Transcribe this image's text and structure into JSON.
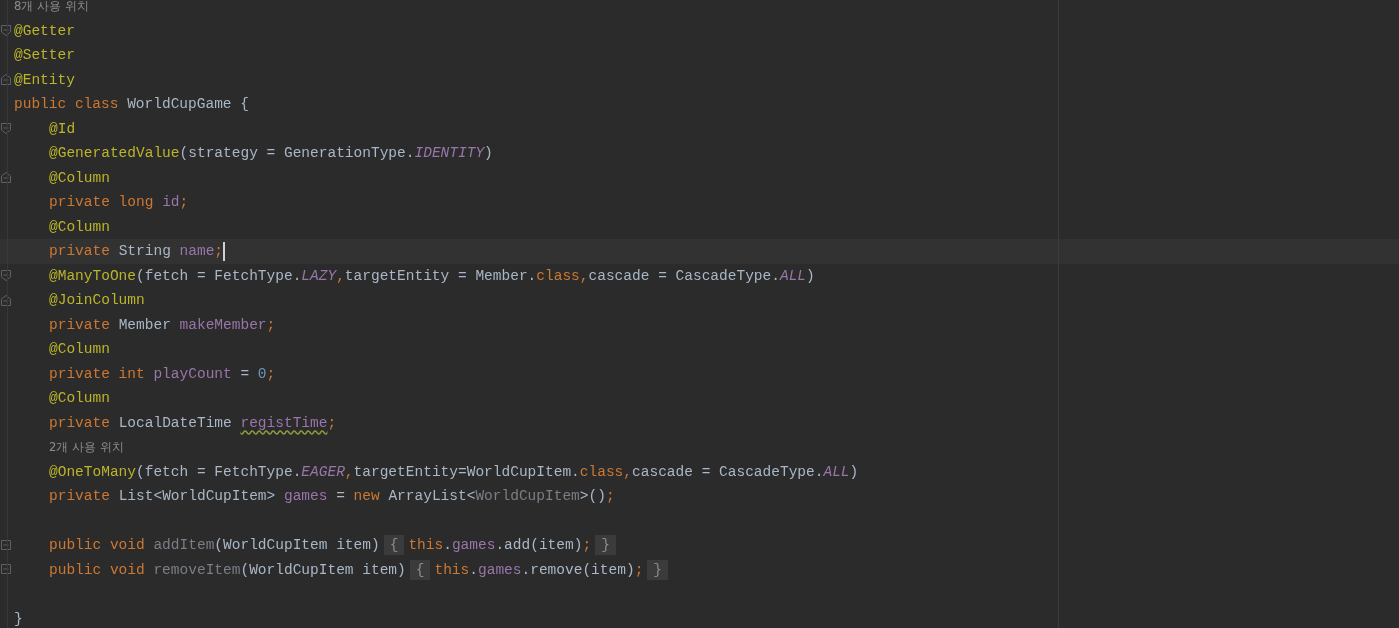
{
  "editor": {
    "lines": [
      {
        "kind": "hint",
        "indented": false,
        "text": "8개 사용 위치"
      },
      {
        "kind": "code",
        "indented": false,
        "fold": {
          "kind": "start"
        },
        "tokens": [
          {
            "kind": "annotation",
            "text": "@Getter"
          }
        ]
      },
      {
        "kind": "code",
        "indented": false,
        "tokens": [
          {
            "kind": "annotation",
            "text": "@Setter"
          }
        ]
      },
      {
        "kind": "code",
        "indented": false,
        "fold": {
          "kind": "end"
        },
        "tokens": [
          {
            "kind": "annotation",
            "text": "@Entity"
          }
        ]
      },
      {
        "kind": "code",
        "indented": false,
        "tokens": [
          {
            "kind": "keyword",
            "text": "public class "
          },
          {
            "kind": "plain",
            "text": "WorldCupGame {"
          }
        ]
      },
      {
        "kind": "code",
        "indented": true,
        "fold": {
          "kind": "start"
        },
        "tokens": [
          {
            "kind": "annotation",
            "text": "@Id"
          }
        ]
      },
      {
        "kind": "code",
        "indented": true,
        "tokens": [
          {
            "kind": "annotation",
            "text": "@GeneratedValue"
          },
          {
            "kind": "plain",
            "text": "(strategy = GenerationType."
          },
          {
            "kind": "constant",
            "text": "IDENTITY"
          },
          {
            "kind": "plain",
            "text": ")"
          }
        ]
      },
      {
        "kind": "code",
        "indented": true,
        "fold": {
          "kind": "end"
        },
        "tokens": [
          {
            "kind": "annotation",
            "text": "@Column"
          }
        ]
      },
      {
        "kind": "code",
        "indented": true,
        "tokens": [
          {
            "kind": "keyword",
            "text": "private long "
          },
          {
            "kind": "field",
            "text": "id"
          },
          {
            "kind": "keyword",
            "text": ";"
          }
        ]
      },
      {
        "kind": "code",
        "indented": true,
        "tokens": [
          {
            "kind": "annotation",
            "text": "@Column"
          }
        ]
      },
      {
        "kind": "code",
        "indented": true,
        "current": true,
        "tokens": [
          {
            "kind": "keyword",
            "text": "private "
          },
          {
            "kind": "plain",
            "text": "String "
          },
          {
            "kind": "field",
            "text": "name"
          },
          {
            "kind": "keyword",
            "text": ";"
          }
        ]
      },
      {
        "kind": "code",
        "indented": true,
        "fold": {
          "kind": "start"
        },
        "tokens": [
          {
            "kind": "annotation",
            "text": "@ManyToOne"
          },
          {
            "kind": "plain",
            "text": "(fetch = FetchType."
          },
          {
            "kind": "constant",
            "text": "LAZY"
          },
          {
            "kind": "keyword",
            "text": ","
          },
          {
            "kind": "plain",
            "text": "targetEntity = Member."
          },
          {
            "kind": "keyword",
            "text": "class,"
          },
          {
            "kind": "plain",
            "text": "cascade = CascadeType."
          },
          {
            "kind": "constant",
            "text": "ALL"
          },
          {
            "kind": "plain",
            "text": ")"
          }
        ]
      },
      {
        "kind": "code",
        "indented": true,
        "fold": {
          "kind": "end"
        },
        "tokens": [
          {
            "kind": "annotation",
            "text": "@JoinColumn"
          }
        ]
      },
      {
        "kind": "code",
        "indented": true,
        "tokens": [
          {
            "kind": "keyword",
            "text": "private "
          },
          {
            "kind": "plain",
            "text": "Member "
          },
          {
            "kind": "field",
            "text": "makeMember"
          },
          {
            "kind": "keyword",
            "text": ";"
          }
        ]
      },
      {
        "kind": "code",
        "indented": true,
        "tokens": [
          {
            "kind": "annotation",
            "text": "@Column"
          }
        ]
      },
      {
        "kind": "code",
        "indented": true,
        "tokens": [
          {
            "kind": "keyword",
            "text": "private int "
          },
          {
            "kind": "field",
            "text": "playCount"
          },
          {
            "kind": "plain",
            "text": " = "
          },
          {
            "kind": "number",
            "text": "0"
          },
          {
            "kind": "keyword",
            "text": ";"
          }
        ]
      },
      {
        "kind": "code",
        "indented": true,
        "tokens": [
          {
            "kind": "annotation",
            "text": "@Column"
          }
        ]
      },
      {
        "kind": "code",
        "indented": true,
        "tokens": [
          {
            "kind": "keyword",
            "text": "private "
          },
          {
            "kind": "plain",
            "text": "LocalDateTime "
          },
          {
            "kind": "field",
            "text": "registTime",
            "warning": true
          },
          {
            "kind": "keyword",
            "text": ";"
          }
        ]
      },
      {
        "kind": "hint",
        "indented": true,
        "text": "2개 사용 위치"
      },
      {
        "kind": "code",
        "indented": true,
        "tokens": [
          {
            "kind": "annotation",
            "text": "@OneToMany"
          },
          {
            "kind": "plain",
            "text": "(fetch = FetchType."
          },
          {
            "kind": "constant",
            "text": "EAGER"
          },
          {
            "kind": "keyword",
            "text": ","
          },
          {
            "kind": "plain",
            "text": "targetEntity=WorldCupItem."
          },
          {
            "kind": "keyword",
            "text": "class,"
          },
          {
            "kind": "plain",
            "text": "cascade = CascadeType."
          },
          {
            "kind": "constant",
            "text": "ALL"
          },
          {
            "kind": "plain",
            "text": ")"
          }
        ]
      },
      {
        "kind": "code",
        "indented": true,
        "tokens": [
          {
            "kind": "keyword",
            "text": "private "
          },
          {
            "kind": "plain",
            "text": "List<WorldCupItem> "
          },
          {
            "kind": "field",
            "text": "games"
          },
          {
            "kind": "plain",
            "text": " = "
          },
          {
            "kind": "keyword",
            "text": "new "
          },
          {
            "kind": "plain",
            "text": "ArrayList<"
          },
          {
            "kind": "unused",
            "text": "WorldCupItem"
          },
          {
            "kind": "plain",
            "text": ">()"
          },
          {
            "kind": "keyword",
            "text": ";"
          }
        ]
      },
      {
        "kind": "blank"
      },
      {
        "kind": "code",
        "indented": true,
        "fold": {
          "kind": "collapsed"
        },
        "tokens": [
          {
            "kind": "keyword",
            "text": "public void "
          },
          {
            "kind": "unused",
            "text": "addItem"
          },
          {
            "kind": "plain",
            "text": "(WorldCupItem item)"
          },
          {
            "kind": "folded",
            "text": "{"
          },
          {
            "kind": "keyword",
            "text": "this"
          },
          {
            "kind": "plain",
            "text": "."
          },
          {
            "kind": "field",
            "text": "games"
          },
          {
            "kind": "plain",
            "text": ".add(item)"
          },
          {
            "kind": "keyword",
            "text": ";"
          },
          {
            "kind": "folded",
            "text": "}"
          }
        ]
      },
      {
        "kind": "code",
        "indented": true,
        "fold": {
          "kind": "collapsed"
        },
        "tokens": [
          {
            "kind": "keyword",
            "text": "public void "
          },
          {
            "kind": "unused",
            "text": "removeItem"
          },
          {
            "kind": "plain",
            "text": "(WorldCupItem item)"
          },
          {
            "kind": "folded",
            "text": "{"
          },
          {
            "kind": "keyword",
            "text": "this"
          },
          {
            "kind": "plain",
            "text": "."
          },
          {
            "kind": "field",
            "text": "games"
          },
          {
            "kind": "plain",
            "text": ".remove(item)"
          },
          {
            "kind": "keyword",
            "text": ";"
          },
          {
            "kind": "folded",
            "text": "}"
          }
        ]
      },
      {
        "kind": "blank"
      },
      {
        "kind": "code",
        "indented": false,
        "tokens": [
          {
            "kind": "plain",
            "text": "}"
          }
        ]
      }
    ]
  }
}
